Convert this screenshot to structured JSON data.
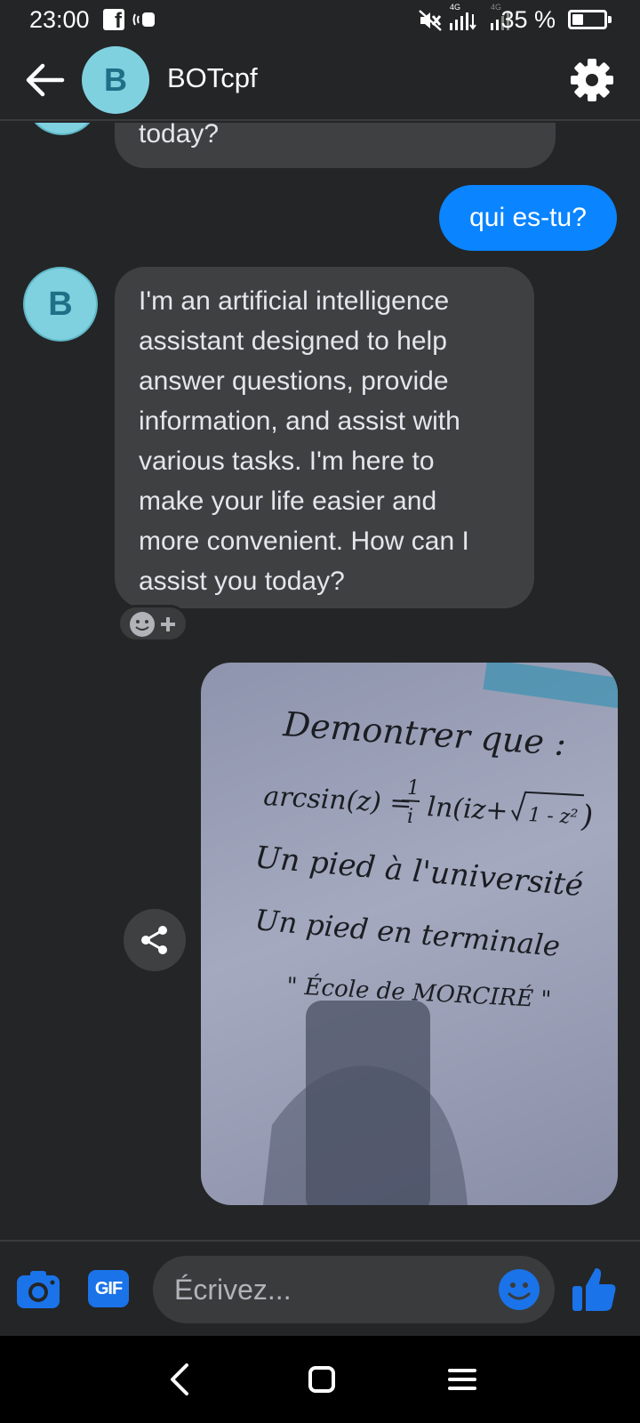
{
  "status_bar": {
    "time": "23:00",
    "battery_percent_text": "35 %",
    "battery_level": 0.35,
    "network_label": "4G",
    "icons": [
      "facebook-icon",
      "notification-icon",
      "mute-icon",
      "signal-icon",
      "battery-icon"
    ]
  },
  "header": {
    "avatar_letter": "B",
    "title": "BOTcpf",
    "icons": [
      "back-arrow-icon",
      "gear-icon"
    ]
  },
  "messages": {
    "partial_incoming": "today?",
    "outgoing_1": "qui es-tu?",
    "incoming_avatar_letter": "B",
    "incoming_1_lines": [
      "I'm an artificial intelligence",
      "assistant designed to help",
      "answer questions, provide",
      "information, and assist with",
      "various tasks. I'm here to",
      "make your life easier and",
      "more convenient. How can I",
      "assist you today?"
    ],
    "reaction_icon": "smiley-add-icon",
    "share_icon": "share-icon"
  },
  "photo": {
    "lines": [
      "Demontrer que :",
      "arcsin(z) = ",
      "Un pied à l'université",
      "Un pied en terminale",
      "\" École de MORCIRÉ \""
    ],
    "fraction_numerator": "1",
    "fraction_denominator": "i",
    "ln_text": "ln(iz+",
    "sqrt_text": "1 - z²",
    "close_paren": ")"
  },
  "composer": {
    "gif_label": "GIF",
    "placeholder": "Écrivez...",
    "icons": [
      "camera-icon",
      "gif-icon",
      "emoji-icon",
      "thumbs-up-icon"
    ]
  },
  "colors": {
    "background": "#242526",
    "incoming_bubble": "#3e4042",
    "outgoing_bubble": "#0a84ff",
    "accent": "#1a73e8",
    "avatar": "#7fd1e0"
  },
  "navbar": {
    "icons": [
      "nav-back-icon",
      "nav-home-icon",
      "nav-menu-icon"
    ]
  }
}
